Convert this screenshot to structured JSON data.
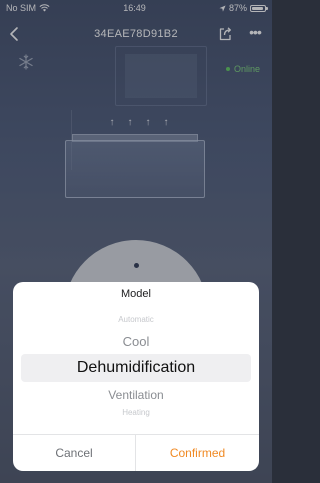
{
  "status_bar": {
    "carrier": "No SIM",
    "time": "16:49",
    "battery": "87%"
  },
  "nav": {
    "title": "34EAE78D91B2"
  },
  "device": {
    "status": "Online"
  },
  "picker": {
    "title": "Model",
    "items": [
      "Automatic",
      "Cool",
      "Dehumidification",
      "Ventilation",
      "Heating"
    ],
    "selected": "Dehumidification",
    "cancel_label": "Cancel",
    "confirm_label": "Confirmed"
  },
  "colors": {
    "accent": "#f08a24",
    "online": "#5cc85c"
  }
}
